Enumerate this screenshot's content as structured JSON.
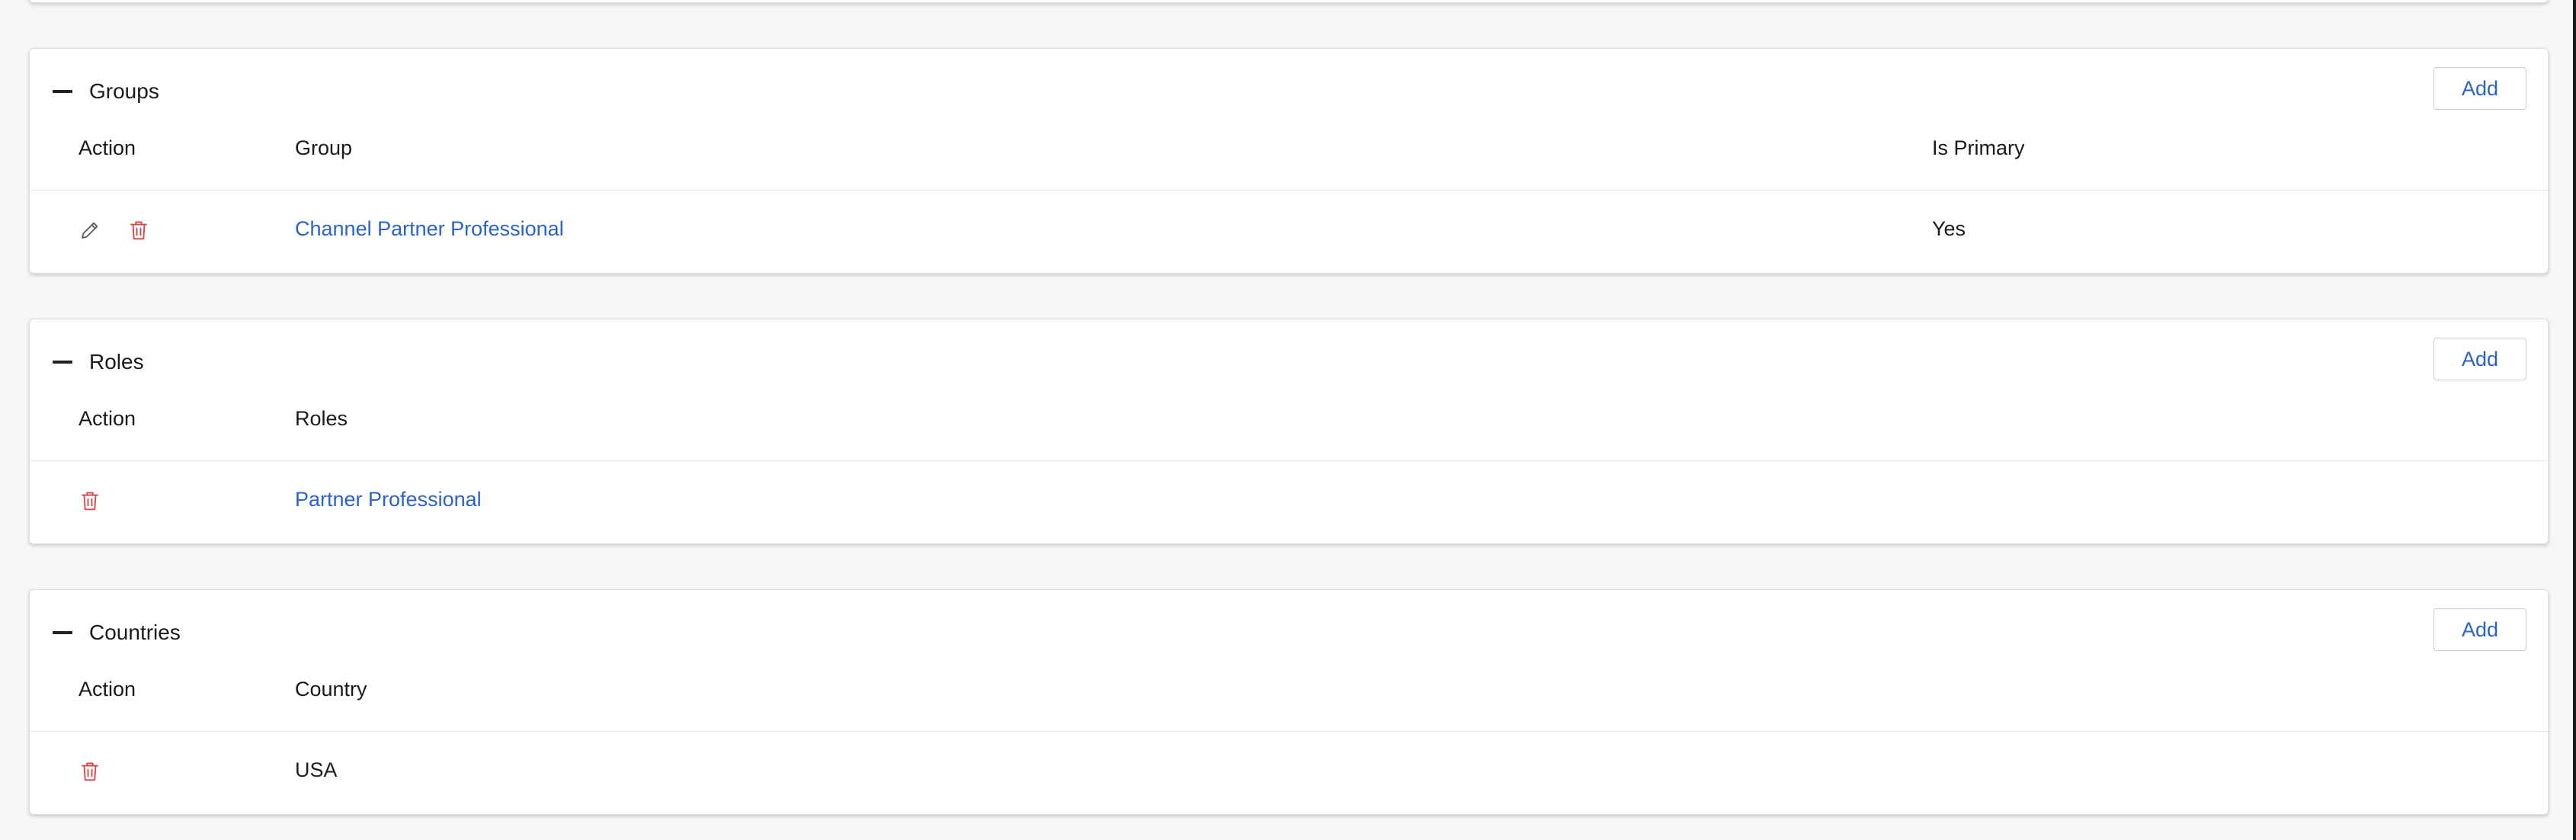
{
  "sections": [
    {
      "title": "Groups",
      "add_label": "Add",
      "columns": [
        "Action",
        "Group",
        "Is Primary"
      ],
      "rows": [
        {
          "group": "Channel Partner Professional",
          "is_primary": "Yes"
        }
      ]
    },
    {
      "title": "Roles",
      "add_label": "Add",
      "columns": [
        "Action",
        "Roles"
      ],
      "rows": [
        {
          "role": "Partner Professional"
        }
      ]
    },
    {
      "title": "Countries",
      "add_label": "Add",
      "columns": [
        "Action",
        "Country"
      ],
      "rows": [
        {
          "country": "USA"
        }
      ]
    }
  ],
  "colors": {
    "link": "#2b63c6",
    "delete": "#d04848",
    "border": "#dcdde0"
  },
  "icons": [
    "minus-icon",
    "pencil-icon",
    "trash-icon"
  ]
}
